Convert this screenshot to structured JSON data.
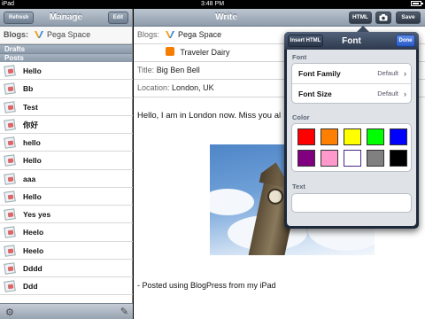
{
  "status": {
    "carrier": "iPad",
    "time": "3:48 PM"
  },
  "left": {
    "refresh": "Refresh",
    "title": "Manage",
    "edit": "Edit",
    "blogs_label": "Blogs:",
    "blog_name": "Pega Space",
    "drafts": "Drafts",
    "posts": "Posts",
    "post_titles": [
      "Hello",
      "Bb",
      "Test",
      "你好",
      "hello",
      "Hello",
      "aaa",
      "Hello",
      "Yes yes",
      "Heelo",
      "Heelo",
      "Dddd",
      "Ddd"
    ]
  },
  "write": {
    "title": "Write",
    "html_btn": "HTML",
    "save_btn": "Save",
    "blogs_label": "Blogs:",
    "blog1": "Pega Space",
    "blog2": "Traveler Dairy",
    "title_label": "Title:",
    "title_value": "Big Ben Bell",
    "location_label": "Location:",
    "location_value": "London, UK",
    "body": "Hello, I am in London now. Miss you al",
    "footer": "- Posted using BlogPress from my iPad"
  },
  "popover": {
    "insert_html": "Insert HTML",
    "title": "Font",
    "done": "Done",
    "font_section": "Font",
    "font_family_label": "Font Family",
    "font_family_value": "Default",
    "font_size_label": "Font Size",
    "font_size_value": "Default",
    "color_section": "Color",
    "colors": [
      "#ff0000",
      "#ff7f00",
      "#ffff00",
      "#00ff00",
      "#0000ff",
      "#800080",
      "#ff99cc",
      "#ffffff",
      "#808080",
      "#000000"
    ],
    "text_section": "Text"
  },
  "colors": {
    "bar": "#8f9cab",
    "popover": "#1d2839",
    "blogger_orange": "#f57d00"
  }
}
